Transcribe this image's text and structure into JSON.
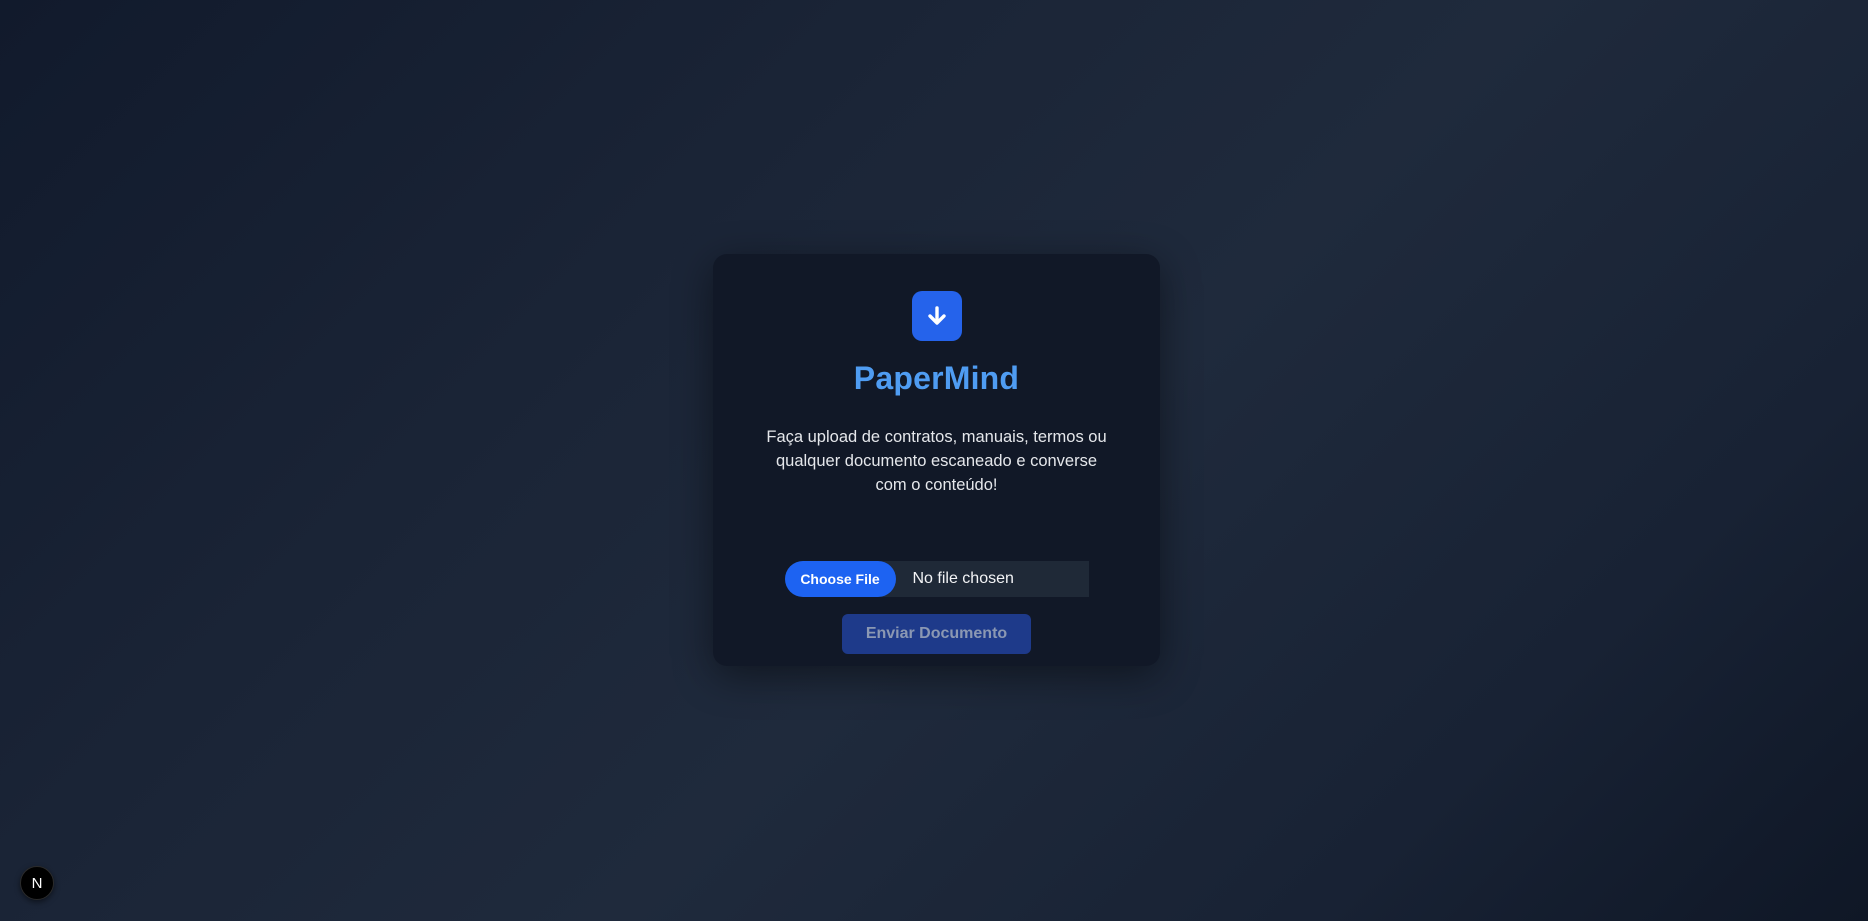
{
  "app": {
    "title": "PaperMind",
    "logo_icon": "download-arrow-icon",
    "accent_color": "#2563eb",
    "title_color": "#4f9cf2"
  },
  "upload": {
    "description": "Faça upload de contratos, manuais, termos ou qualquer documento escaneado e converse com o conteúdo!",
    "choose_file_label": "Choose File",
    "file_status": "No file chosen",
    "submit_label": "Enviar Documento",
    "submit_disabled": true
  },
  "dev_badge": {
    "letter": "N",
    "icon": "nextjs-logo-icon"
  }
}
